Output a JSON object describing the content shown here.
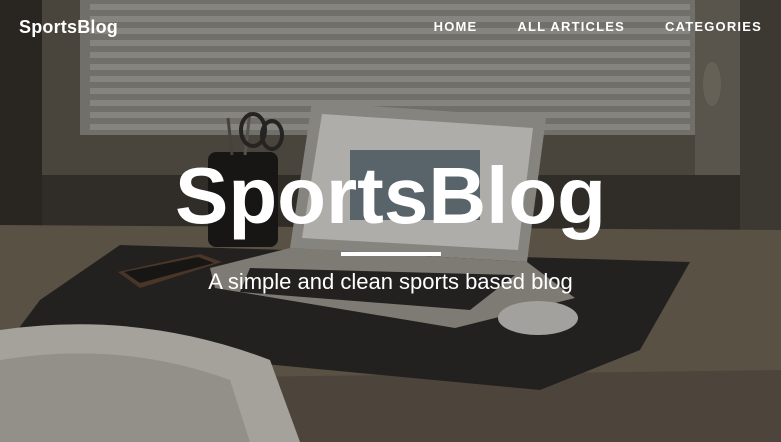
{
  "navbar": {
    "brand": "SportsBlog",
    "links": [
      "HOME",
      "ALL ARTICLES",
      "CATEGORIES"
    ]
  },
  "header": {
    "title": "SportsBlog",
    "subtitle": "A simple and clean sports based blog"
  },
  "colors": {
    "text": "#ffffff",
    "background_tint": "#2a2824"
  }
}
